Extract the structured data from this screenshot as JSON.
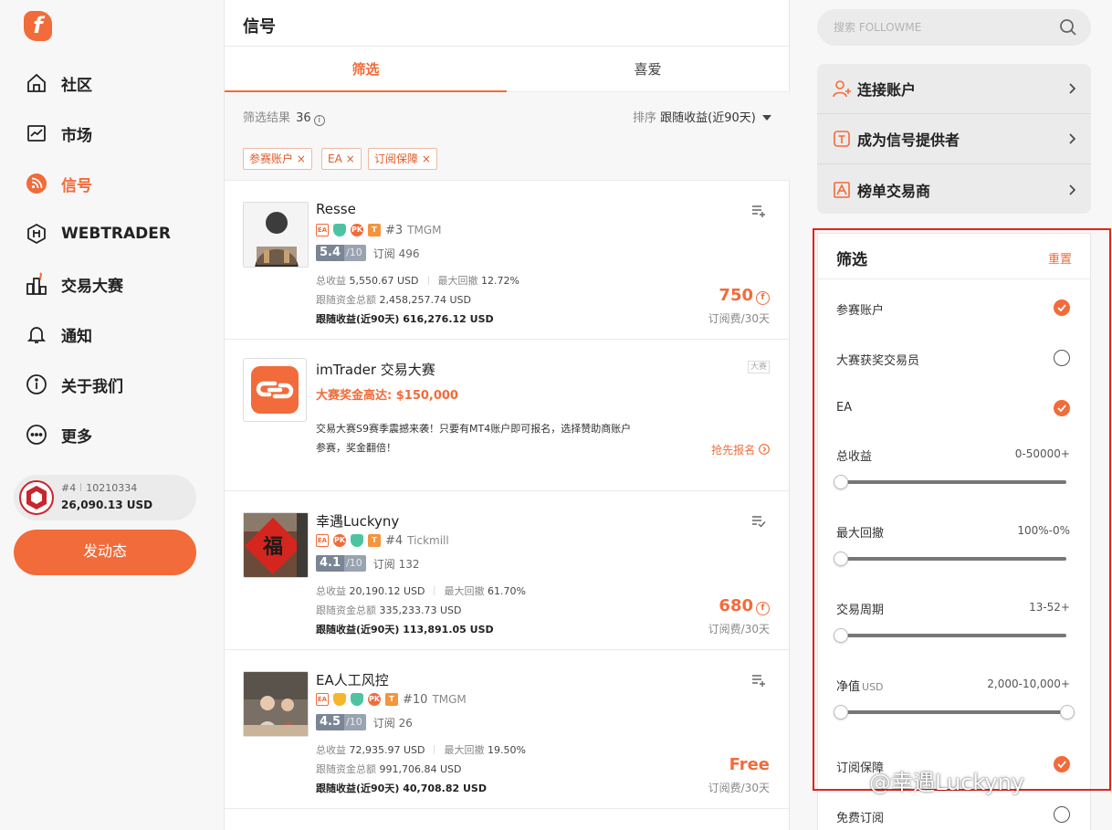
{
  "brand": {
    "accent": "#f26b3a",
    "logo_glyph": "f"
  },
  "nav": {
    "items": [
      {
        "label": "社区",
        "icon": "home-icon"
      },
      {
        "label": "市场",
        "icon": "chart-icon"
      },
      {
        "label": "信号",
        "icon": "rss-icon",
        "active": true
      },
      {
        "label": "WEBTRADER",
        "icon": "webtrader-icon"
      },
      {
        "label": "交易大赛",
        "icon": "competition-icon"
      },
      {
        "label": "通知",
        "icon": "bell-icon"
      },
      {
        "label": "关于我们",
        "icon": "info-icon"
      },
      {
        "label": "更多",
        "icon": "more-icon"
      }
    ]
  },
  "user": {
    "rank": "#4",
    "account": "10210334",
    "balance": "26,090.13 USD"
  },
  "post_button": "发动态",
  "main": {
    "title": "信号",
    "tabs": [
      {
        "label": "筛选",
        "active": true
      },
      {
        "label": "喜爱"
      }
    ],
    "filter_result_label": "筛选结果",
    "filter_result_count": "36",
    "sort_label": "排序",
    "sort_value": "跟随收益(近90天)",
    "tags": [
      "参赛账户 ×",
      "EA ×",
      "订阅保障 ×"
    ]
  },
  "signals": [
    {
      "name": "Resse",
      "rank": "#3",
      "broker": "TMGM",
      "score": "5.4",
      "score_max": "/10",
      "subs_label": "订阅",
      "subs": "496",
      "total_label": "总收益",
      "total": "5,550.67 USD",
      "dd_label": "最大回撤",
      "dd": "12.72%",
      "funds_label": "跟随资金总额",
      "funds": "2,458,257.74 USD",
      "follow_label": "跟随收益(近90天)",
      "follow": "616,276.12 USD",
      "price": "750",
      "per": "订阅费/30天"
    },
    {
      "name": "幸遇Luckyny",
      "rank": "#4",
      "broker": "Tickmill",
      "score": "4.1",
      "score_max": "/10",
      "subs_label": "订阅",
      "subs": "132",
      "total_label": "总收益",
      "total": "20,190.12 USD",
      "dd_label": "最大回撤",
      "dd": "61.70%",
      "funds_label": "跟随资金总额",
      "funds": "335,233.73 USD",
      "follow_label": "跟随收益(近90天)",
      "follow": "113,891.05 USD",
      "price": "680",
      "per": "订阅费/30天"
    },
    {
      "name": "EA人工风控",
      "rank": "#10",
      "broker": "TMGM",
      "score": "4.5",
      "score_max": "/10",
      "subs_label": "订阅",
      "subs": "26",
      "total_label": "总收益",
      "total": "72,935.97 USD",
      "dd_label": "最大回撤",
      "dd": "19.50%",
      "funds_label": "跟随资金总额",
      "funds": "991,706.84 USD",
      "follow_label": "跟随收益(近90天)",
      "follow": "40,708.82 USD",
      "price": "Free",
      "per": "订阅费/30天"
    }
  ],
  "promo": {
    "title": "imTrader 交易大赛",
    "tag": "大赛",
    "subtitle": "大赛奖金高达: $150,000",
    "desc": "交易大赛S9赛季震撼来袭！只要有MT4账户即可报名，选择赞助商账户参赛，奖金翻倍！",
    "link": "抢先报名"
  },
  "badge_text": {
    "ea": "EA",
    "pk": "PK",
    "t": "T",
    "coin": "f"
  },
  "right": {
    "search_placeholder": "搜索 FOLLOWME",
    "links": [
      "连接账户",
      "成为信号提供者",
      "榜单交易商"
    ]
  },
  "filter_panel": {
    "title": "筛选",
    "reset": "重置",
    "toggles": [
      {
        "label": "参赛账户",
        "on": true
      },
      {
        "label": "大赛获奖交易员",
        "on": false
      },
      {
        "label": "EA",
        "on": true
      }
    ],
    "ranges": [
      {
        "label": "总收益",
        "unit": "",
        "value": "0-50000+"
      },
      {
        "label": "最大回撤",
        "unit": "",
        "value": "100%-0%"
      },
      {
        "label": "交易周期",
        "unit": "",
        "value": "13-52+"
      },
      {
        "label": "净值",
        "unit": "USD",
        "value": "2,000-10,000+"
      }
    ],
    "toggles2": [
      {
        "label": "订阅保障",
        "on": true
      },
      {
        "label": "免费订阅",
        "on": false
      }
    ]
  },
  "watermark": "@幸遇Luckyny"
}
